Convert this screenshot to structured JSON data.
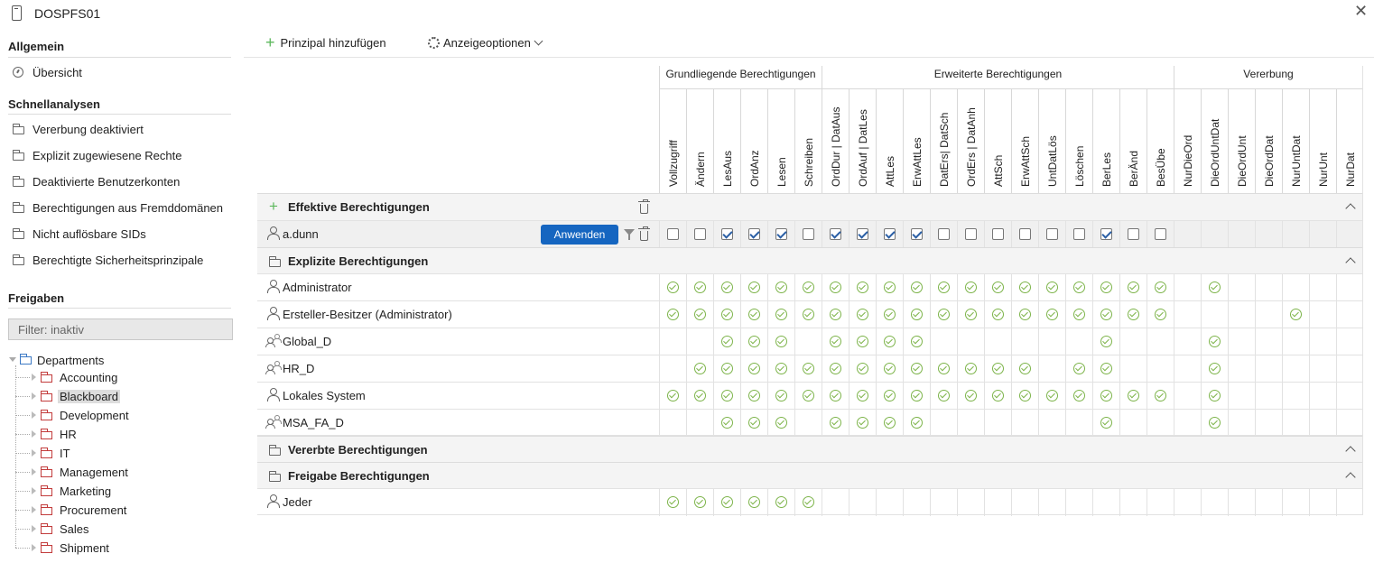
{
  "window": {
    "title": "DOSPFS01",
    "close_glyph": "✕"
  },
  "sidebar": {
    "general_heading": "Allgemein",
    "overview_label": "Übersicht",
    "quick_heading": "Schnellanalysen",
    "quick_items": [
      "Vererbung deaktiviert",
      "Explizit zugewiesene Rechte",
      "Deaktivierte Benutzerkonten",
      "Berechtigungen aus Fremddomänen",
      "Nicht auflösbare SIDs",
      "Berechtigte Sicherheitsprinzipale"
    ],
    "shares_heading": "Freigaben",
    "filter_placeholder": "Filter: inaktiv",
    "tree_root": "Departments",
    "tree_children": [
      "Accounting",
      "Blackboard",
      "Development",
      "HR",
      "IT",
      "Management",
      "Marketing",
      "Procurement",
      "Sales",
      "Shipment"
    ],
    "tree_selected": "Blackboard"
  },
  "toolbar": {
    "add_principal": "Prinzipal hinzufügen",
    "view_options": "Anzeigeoptionen"
  },
  "groups": {
    "basic": "Grundliegende Berechtigungen",
    "extended": "Erweiterte Berechtigungen",
    "inheritance": "Vererbung"
  },
  "columns": [
    "Vollzugriff",
    "Ändern",
    "LesAus",
    "OrdAnz",
    "Lesen",
    "Schreiben",
    "OrdDur | DatAus",
    "OrdAuf | DatLes",
    "AttLes",
    "ErwAttLes",
    "DatErs| DatSch",
    "OrdErs | DatAnh",
    "AttSch",
    "ErwAttSch",
    "UntDatLös",
    "Löschen",
    "BerLes",
    "BerÄnd",
    "BesÜbe",
    "NurDieOrd",
    "DieOrdUntDat",
    "DieOrdUnt",
    "DieOrdDat",
    "NurUntDat",
    "NurUnt",
    "NurDat"
  ],
  "effective": {
    "heading": "Effektive Berechtigungen",
    "user": "a.dunn",
    "apply_label": "Anwenden",
    "checks": [
      0,
      0,
      1,
      1,
      1,
      0,
      1,
      1,
      1,
      1,
      0,
      0,
      0,
      0,
      0,
      0,
      1,
      0,
      0
    ]
  },
  "explicit": {
    "heading": "Explizite Berechtigungen",
    "rows": [
      {
        "name": "Administrator",
        "type": "user",
        "perms": [
          1,
          1,
          1,
          1,
          1,
          1,
          1,
          1,
          1,
          1,
          1,
          1,
          1,
          1,
          1,
          1,
          1,
          1,
          1,
          0,
          1,
          0,
          0,
          0,
          0,
          0
        ]
      },
      {
        "name": "Ersteller-Besitzer (Administrator)",
        "type": "user",
        "perms": [
          1,
          1,
          1,
          1,
          1,
          1,
          1,
          1,
          1,
          1,
          1,
          1,
          1,
          1,
          1,
          1,
          1,
          1,
          1,
          0,
          0,
          0,
          0,
          1,
          0,
          0
        ]
      },
      {
        "name": "Global_D",
        "type": "group",
        "perms": [
          0,
          0,
          1,
          1,
          1,
          0,
          1,
          1,
          1,
          1,
          0,
          0,
          0,
          0,
          0,
          0,
          1,
          0,
          0,
          0,
          1,
          0,
          0,
          0,
          0,
          0
        ]
      },
      {
        "name": "HR_D",
        "type": "group",
        "perms": [
          0,
          1,
          1,
          1,
          1,
          1,
          1,
          1,
          1,
          1,
          1,
          1,
          1,
          1,
          0,
          1,
          1,
          0,
          0,
          0,
          1,
          0,
          0,
          0,
          0,
          0
        ]
      },
      {
        "name": "Lokales System",
        "type": "user",
        "perms": [
          1,
          1,
          1,
          1,
          1,
          1,
          1,
          1,
          1,
          1,
          1,
          1,
          1,
          1,
          1,
          1,
          1,
          1,
          1,
          0,
          1,
          0,
          0,
          0,
          0,
          0
        ]
      },
      {
        "name": "MSA_FA_D",
        "type": "group",
        "perms": [
          0,
          0,
          1,
          1,
          1,
          0,
          1,
          1,
          1,
          1,
          0,
          0,
          0,
          0,
          0,
          0,
          1,
          0,
          0,
          0,
          1,
          0,
          0,
          0,
          0,
          0
        ]
      }
    ]
  },
  "inherited": {
    "heading": "Vererbte Berechtigungen"
  },
  "share": {
    "heading": "Freigabe Berechtigungen",
    "rows": [
      {
        "name": "Jeder",
        "type": "user",
        "perms": [
          1,
          1,
          1,
          1,
          1,
          1,
          0,
          0,
          0,
          0,
          0,
          0,
          0,
          0,
          0,
          0,
          0,
          0,
          0,
          0,
          0,
          0,
          0,
          0,
          0,
          0
        ]
      }
    ]
  }
}
